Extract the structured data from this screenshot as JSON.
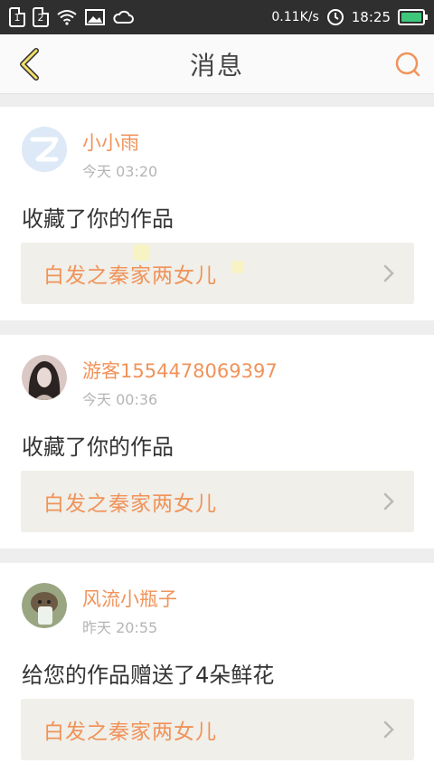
{
  "status_bar": {
    "sim1": "1",
    "sim2": "2",
    "network_speed": "0.11K/s",
    "time": "18:25"
  },
  "header": {
    "title": "消息"
  },
  "messages": [
    {
      "username": "小小雨",
      "time": "今天 03:20",
      "action": "收藏了你的作品",
      "work_title": "白发之秦家两女儿"
    },
    {
      "username": "游客15544780693​97",
      "time": "今天 00:36",
      "action": "收藏了你的作品",
      "work_title": "白发之秦家两女儿"
    },
    {
      "username": "风流小瓶子",
      "time": "昨天 20:55",
      "action": "给您的作品赠送了4朵鲜花",
      "work_title": "白发之秦家两女儿"
    }
  ],
  "colors": {
    "accent": "#f0935a",
    "status_bar_bg": "#2f2f2f",
    "battery": "#3ec77a"
  }
}
